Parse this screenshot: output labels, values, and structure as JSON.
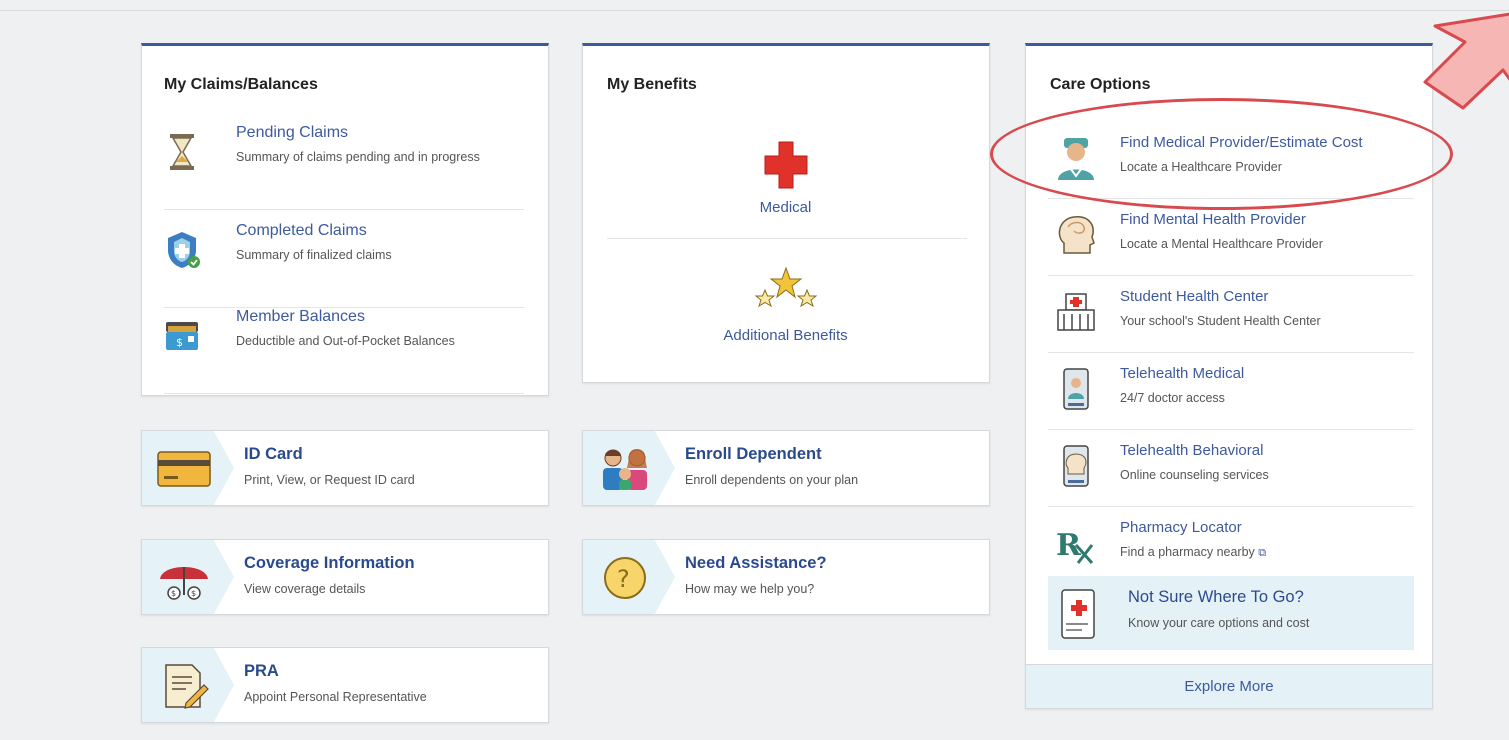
{
  "claims": {
    "title": "My Claims/Balances",
    "items": [
      {
        "title": "Pending Claims",
        "desc": "Summary of claims pending and in progress",
        "icon": "hourglass-icon"
      },
      {
        "title": "Completed Claims",
        "desc": "Summary of finalized claims",
        "icon": "shield-check-icon"
      },
      {
        "title": "Member Balances",
        "desc": "Deductible and Out-of-Pocket Balances",
        "icon": "wallet-icon"
      }
    ]
  },
  "benefits": {
    "title": "My Benefits",
    "items": [
      {
        "label": "Medical",
        "icon": "medical-cross-icon"
      },
      {
        "label": "Additional Benefits",
        "icon": "stars-icon"
      }
    ]
  },
  "tiles": {
    "id_card": {
      "title": "ID Card",
      "desc": "Print, View, or Request ID card"
    },
    "coverage": {
      "title": "Coverage Information",
      "desc": "View coverage details"
    },
    "pra": {
      "title": "PRA",
      "desc": "Appoint Personal Representative"
    },
    "enroll": {
      "title": "Enroll Dependent",
      "desc": "Enroll dependents on your plan"
    },
    "assist": {
      "title": "Need Assistance?",
      "desc": "How may we help you?"
    }
  },
  "care": {
    "title": "Care Options",
    "items": [
      {
        "title": "Find Medical Provider/Estimate Cost",
        "desc": "Locate a Healthcare Provider",
        "icon": "doctor-icon"
      },
      {
        "title": "Find Mental Health Provider",
        "desc": "Locate a Mental Healthcare Provider",
        "icon": "head-icon"
      },
      {
        "title": "Student Health Center",
        "desc": "Your school's Student Health Center",
        "icon": "hospital-icon"
      },
      {
        "title": "Telehealth Medical",
        "desc": "24/7 doctor access",
        "icon": "phone-doctor-icon"
      },
      {
        "title": "Telehealth Behavioral",
        "desc": "Online counseling services",
        "icon": "phone-counselor-icon"
      },
      {
        "title": "Pharmacy Locator",
        "desc": "Find a pharmacy nearby",
        "icon": "rx-icon"
      }
    ],
    "not_sure": {
      "title": "Not Sure Where To Go?",
      "desc": "Know your care options and cost"
    },
    "explore": "Explore More"
  },
  "colors": {
    "accent": "#3d5a9e",
    "highlight": "#d94a4f",
    "arrow": "#f6b6b3"
  }
}
